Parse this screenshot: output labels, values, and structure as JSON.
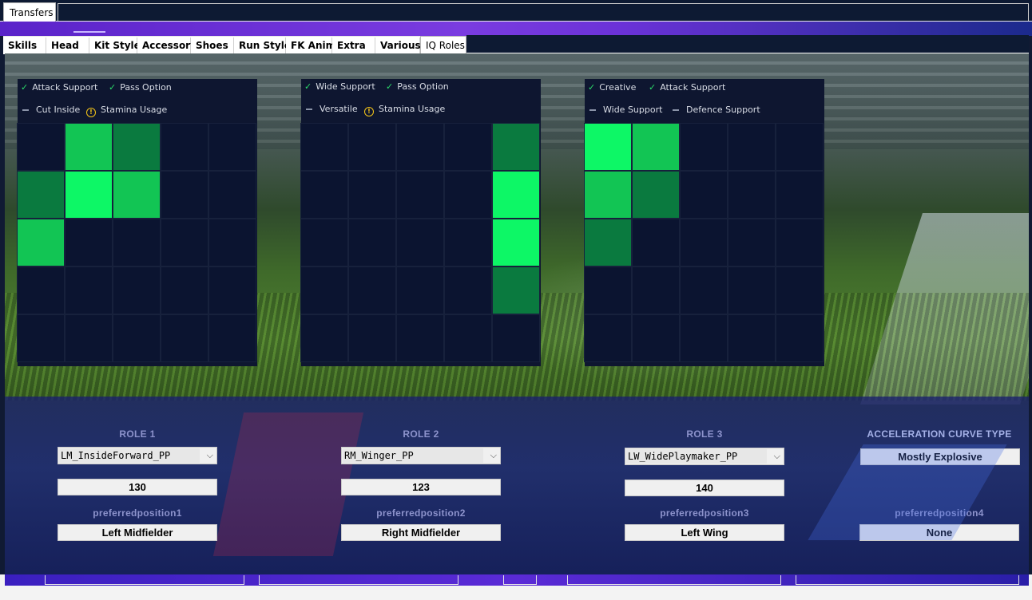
{
  "top_tab": {
    "label": "Transfers"
  },
  "subtabs": [
    {
      "label": "Skills"
    },
    {
      "label": "Head"
    },
    {
      "label": "Kit Style"
    },
    {
      "label": "Accessory"
    },
    {
      "label": "Shoes"
    },
    {
      "label": "Run Style"
    },
    {
      "label": "FK Anim"
    },
    {
      "label": "Extra"
    },
    {
      "label": "Various"
    },
    {
      "label": "IQ Roles"
    }
  ],
  "active_subtab": "IQ Roles",
  "colors": {
    "grid_dark": "#0a7a3f",
    "grid_mid": "#12c554",
    "grid_bright": "#0df766",
    "grid_empty": "#0b1430",
    "check": "#2bdc6a",
    "warning": "#f5c518"
  },
  "roles": [
    {
      "label": "ROLE 1",
      "traits": [
        {
          "icon": "check-icon",
          "text": "Attack Support"
        },
        {
          "icon": "check-icon",
          "text": "Pass Option"
        },
        {
          "icon": "dash-icon",
          "text": "Cut Inside"
        },
        {
          "icon": "warning-icon",
          "text": "Stamina Usage"
        }
      ],
      "heatmap": [
        [
          0,
          2,
          1,
          0,
          0
        ],
        [
          1,
          3,
          2,
          0,
          0
        ],
        [
          2,
          0,
          0,
          0,
          0
        ],
        [
          0,
          0,
          0,
          0,
          0
        ],
        [
          0,
          0,
          0,
          0,
          0
        ]
      ],
      "selected": "LM_InsideForward_PP",
      "value": "130",
      "pref_label": "preferredposition1",
      "pref_value": "Left Midfielder"
    },
    {
      "label": "ROLE 2",
      "traits": [
        {
          "icon": "check-icon",
          "text": "Wide Support"
        },
        {
          "icon": "check-icon",
          "text": "Pass Option"
        },
        {
          "icon": "dash-icon",
          "text": "Versatile"
        },
        {
          "icon": "warning-icon",
          "text": "Stamina Usage"
        }
      ],
      "heatmap": [
        [
          0,
          0,
          0,
          0,
          1
        ],
        [
          0,
          0,
          0,
          0,
          3
        ],
        [
          0,
          0,
          0,
          0,
          3
        ],
        [
          0,
          0,
          0,
          0,
          1
        ],
        [
          0,
          0,
          0,
          0,
          0
        ]
      ],
      "selected": "RM_Winger_PP",
      "value": "123",
      "pref_label": "preferredposition2",
      "pref_value": "Right Midfielder"
    },
    {
      "label": "ROLE 3",
      "traits": [
        {
          "icon": "check-icon",
          "text": "Creative"
        },
        {
          "icon": "check-icon",
          "text": "Attack Support"
        },
        {
          "icon": "dash-icon",
          "text": "Wide Support"
        },
        {
          "icon": "dash-icon",
          "text": "Defence Support"
        }
      ],
      "heatmap": [
        [
          3,
          2,
          0,
          0,
          0
        ],
        [
          2,
          1,
          0,
          0,
          0
        ],
        [
          1,
          0,
          0,
          0,
          0
        ],
        [
          0,
          0,
          0,
          0,
          0
        ],
        [
          0,
          0,
          0,
          0,
          0
        ]
      ],
      "selected": "LW_WidePlaymaker_PP",
      "value": "140",
      "pref_label": "preferredposition3",
      "pref_value": "Left Wing"
    }
  ],
  "acceleration": {
    "label": "ACCELERATION CURVE TYPE",
    "value": "Mostly Explosive",
    "pref_label": "preferredposition4",
    "pref_value": "None"
  }
}
